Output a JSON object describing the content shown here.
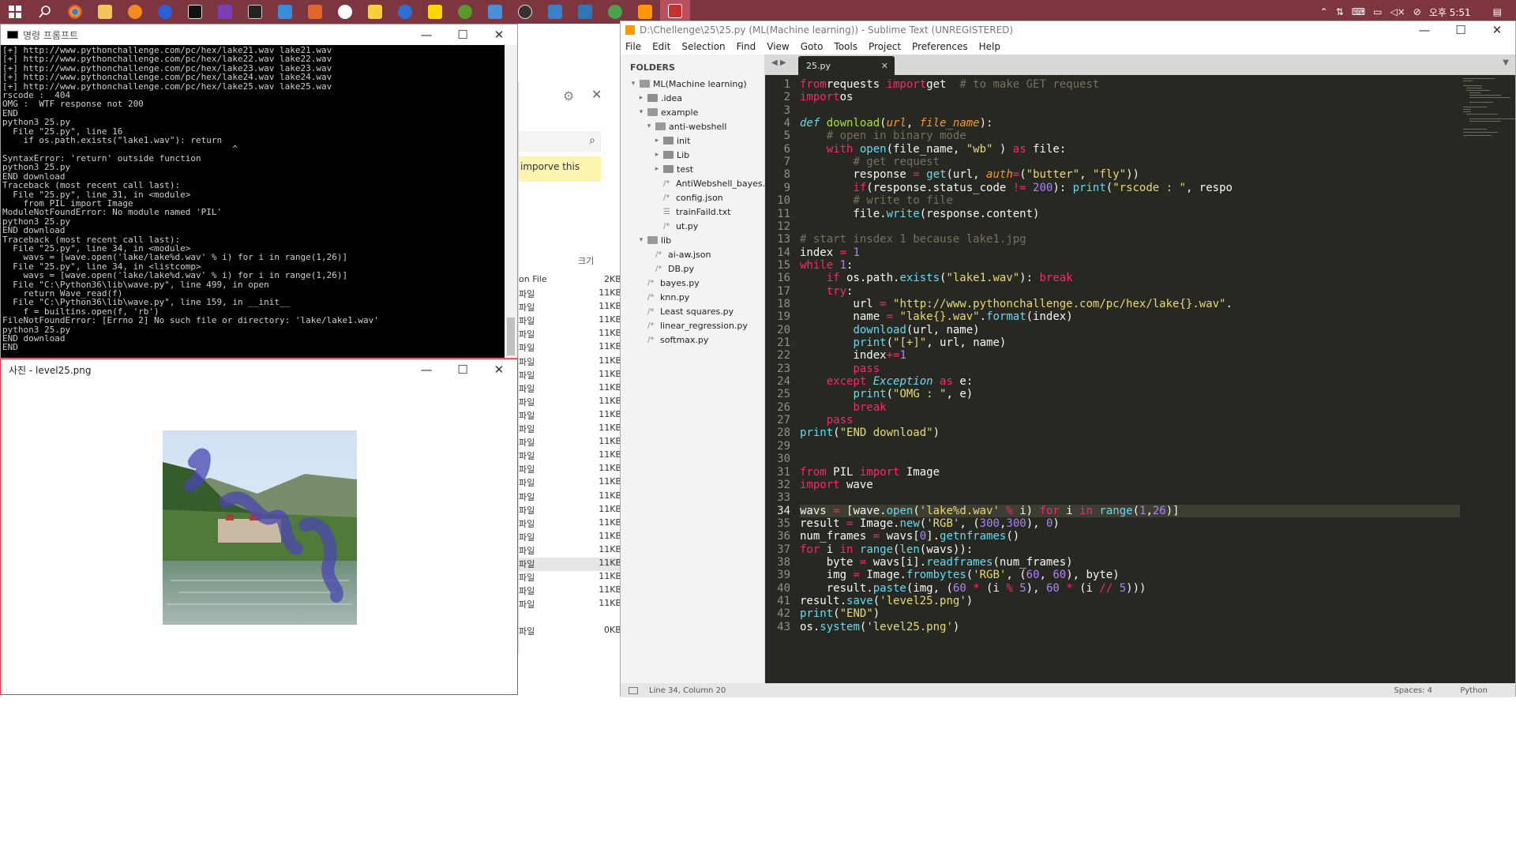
{
  "taskbar": {
    "clock": "오후 5:51"
  },
  "cmd": {
    "title": "명령 프롬프트",
    "lines": [
      "[+] http://www.pythonchallenge.com/pc/hex/lake21.wav lake21.wav",
      "[+] http://www.pythonchallenge.com/pc/hex/lake22.wav lake22.wav",
      "[+] http://www.pythonchallenge.com/pc/hex/lake23.wav lake23.wav",
      "[+] http://www.pythonchallenge.com/pc/hex/lake24.wav lake24.wav",
      "[+] http://www.pythonchallenge.com/pc/hex/lake25.wav lake25.wav",
      "rscode :  404",
      "OMG :  WTF response not 200",
      "END",
      "python3 25.py",
      "  File \"25.py\", line 16",
      "    if os.path.exists(\"lake1.wav\"): return",
      "                                            ^",
      "SyntaxError: 'return' outside function",
      "python3 25.py",
      "END download",
      "Traceback (most recent call last):",
      "  File \"25.py\", line 31, in <module>",
      "    from PIL import Image",
      "ModuleNotFoundError: No module named 'PIL'",
      "python3 25.py",
      "END download",
      "Traceback (most recent call last):",
      "  File \"25.py\", line 34, in <module>",
      "    wavs = [wave.open('lake/lake%d.wav' % i) for i in range(1,26)]",
      "  File \"25.py\", line 34, in <listcomp>",
      "    wavs = [wave.open('lake/lake%d.wav' % i) for i in range(1,26)]",
      "  File \"C:\\Python36\\lib\\wave.py\", line 499, in open",
      "    return Wave_read(f)",
      "  File \"C:\\Python36\\lib\\wave.py\", line 159, in __init__",
      "    f = builtins.open(f, 'rb')",
      "FileNotFoundError: [Errno 2] No such file or directory: 'lake/lake1.wav'",
      "python3 25.py",
      "END download",
      "END"
    ]
  },
  "photos": {
    "title": "사진 - level25.png"
  },
  "explorer": {
    "search_hint": "imporve this",
    "col_size": "크기",
    "first_type": "on File",
    "first_size": "2KB",
    "file_type": "파일",
    "file_size": "11KB",
    "last_size": "0KB"
  },
  "sublime": {
    "title": "D:\\Chellenge\\25\\25.py (ML(Machine learning)) - Sublime Text (UNREGISTERED)",
    "menu": [
      "File",
      "Edit",
      "Selection",
      "Find",
      "View",
      "Goto",
      "Tools",
      "Project",
      "Preferences",
      "Help"
    ],
    "folders_label": "FOLDERS",
    "tab": "25.py",
    "tree": [
      {
        "label": "ML(Machine learning)",
        "type": "folder-open",
        "depth": 0
      },
      {
        "label": ".idea",
        "type": "folder",
        "depth": 1
      },
      {
        "label": "example",
        "type": "folder-open",
        "depth": 1
      },
      {
        "label": "anti-webshell",
        "type": "folder-open",
        "depth": 2
      },
      {
        "label": "init",
        "type": "folder",
        "depth": 3
      },
      {
        "label": "Lib",
        "type": "folder",
        "depth": 3
      },
      {
        "label": "test",
        "type": "folder",
        "depth": 3
      },
      {
        "label": "AntiWebshell_bayes.py",
        "type": "file",
        "depth": 3
      },
      {
        "label": "config.json",
        "type": "file",
        "depth": 3
      },
      {
        "label": "trainFaild.txt",
        "type": "text",
        "depth": 3
      },
      {
        "label": "ut.py",
        "type": "file",
        "depth": 3
      },
      {
        "label": "lib",
        "type": "folder-open",
        "depth": 1
      },
      {
        "label": "ai-aw.json",
        "type": "file",
        "depth": 2
      },
      {
        "label": "DB.py",
        "type": "file",
        "depth": 2
      },
      {
        "label": "bayes.py",
        "type": "file",
        "depth": 1
      },
      {
        "label": "knn.py",
        "type": "file",
        "depth": 1
      },
      {
        "label": "Least squares.py",
        "type": "file",
        "depth": 1
      },
      {
        "label": "linear_regression.py",
        "type": "file",
        "depth": 1
      },
      {
        "label": "softmax.py",
        "type": "file",
        "depth": 1
      }
    ],
    "code": [
      [
        [
          "kw",
          "from"
        ],
        [
          "",
          "requests "
        ],
        [
          "kw",
          "import"
        ],
        [
          "",
          "get  "
        ],
        [
          "cm",
          "# to make GET request"
        ]
      ],
      [
        [
          "kw",
          "import"
        ],
        [
          "",
          "os"
        ]
      ],
      [],
      [
        [
          "it",
          "def "
        ],
        [
          "fn",
          "download"
        ],
        [
          "",
          "("
        ],
        [
          "pa",
          "url"
        ],
        [
          "",
          ", "
        ],
        [
          "pa",
          "file_name"
        ],
        [
          "",
          "):"
        ]
      ],
      [
        [
          "",
          "    "
        ],
        [
          "cm",
          "# open in binary mode"
        ]
      ],
      [
        [
          "",
          "    "
        ],
        [
          "kw",
          "with "
        ],
        [
          "bi",
          "open"
        ],
        [
          "",
          "(file_name, "
        ],
        [
          "st",
          "\"wb\""
        ],
        [
          "",
          " ) "
        ],
        [
          "kw",
          "as"
        ],
        [
          "",
          " file:"
        ]
      ],
      [
        [
          "",
          "        "
        ],
        [
          "cm",
          "# get request"
        ]
      ],
      [
        [
          "",
          "        response "
        ],
        [
          "kw",
          "="
        ],
        [
          "",
          " "
        ],
        [
          "bi",
          "get"
        ],
        [
          "",
          "(url, "
        ],
        [
          "pa",
          "auth"
        ],
        [
          "kw",
          "="
        ],
        [
          "",
          "("
        ],
        [
          "st",
          "\"butter\""
        ],
        [
          "",
          ", "
        ],
        [
          "st",
          "\"fly\""
        ],
        [
          "",
          "))"
        ]
      ],
      [
        [
          "",
          "        "
        ],
        [
          "kw",
          "if"
        ],
        [
          "",
          "(response.status_code "
        ],
        [
          "kw",
          "!="
        ],
        [
          "",
          " "
        ],
        [
          "nm",
          "200"
        ],
        [
          "",
          "): "
        ],
        [
          "bi",
          "print"
        ],
        [
          "",
          "("
        ],
        [
          "st",
          "\"rscode : \""
        ],
        [
          "",
          ", respo"
        ]
      ],
      [
        [
          "",
          "        "
        ],
        [
          "cm",
          "# write to file"
        ]
      ],
      [
        [
          "",
          "        file."
        ],
        [
          "bi",
          "write"
        ],
        [
          "",
          "(response.content)"
        ]
      ],
      [],
      [
        [
          "cm",
          "# start insdex 1 because lake1.jpg"
        ]
      ],
      [
        [
          "",
          "index "
        ],
        [
          "kw",
          "="
        ],
        [
          "",
          " "
        ],
        [
          "nm",
          "1"
        ]
      ],
      [
        [
          "kw",
          "while"
        ],
        [
          "",
          " "
        ],
        [
          "nm",
          "1"
        ],
        [
          "",
          ":"
        ]
      ],
      [
        [
          "",
          "    "
        ],
        [
          "kw",
          "if"
        ],
        [
          "",
          " os.path."
        ],
        [
          "bi",
          "exists"
        ],
        [
          "",
          "("
        ],
        [
          "st",
          "\"lake1.wav\""
        ],
        [
          "",
          "): "
        ],
        [
          "kw",
          "break"
        ]
      ],
      [
        [
          "",
          "    "
        ],
        [
          "kw",
          "try"
        ],
        [
          "",
          ":"
        ]
      ],
      [
        [
          "",
          "        url "
        ],
        [
          "kw",
          "="
        ],
        [
          "",
          " "
        ],
        [
          "st",
          "\"http://www.pythonchallenge.com/pc/hex/lake{}.wav\""
        ],
        [
          "",
          "."
        ]
      ],
      [
        [
          "",
          "        name "
        ],
        [
          "kw",
          "="
        ],
        [
          "",
          " "
        ],
        [
          "st",
          "\"lake{}.wav\""
        ],
        [
          "",
          "."
        ],
        [
          "bi",
          "format"
        ],
        [
          "",
          "(index)"
        ]
      ],
      [
        [
          "",
          "        "
        ],
        [
          "bi",
          "download"
        ],
        [
          "",
          "(url, name)"
        ]
      ],
      [
        [
          "",
          "        "
        ],
        [
          "bi",
          "print"
        ],
        [
          "",
          "("
        ],
        [
          "st",
          "\"[+]\""
        ],
        [
          "",
          ", url, name)"
        ]
      ],
      [
        [
          "",
          "        index"
        ],
        [
          "kw",
          "+="
        ],
        [
          "nm",
          "1"
        ]
      ],
      [
        [
          "",
          "        "
        ],
        [
          "kw",
          "pass"
        ]
      ],
      [
        [
          "",
          "    "
        ],
        [
          "kw",
          "except"
        ],
        [
          "",
          " "
        ],
        [
          "it",
          "Exception"
        ],
        [
          "",
          " "
        ],
        [
          "kw",
          "as"
        ],
        [
          "",
          " e:"
        ]
      ],
      [
        [
          "",
          "        "
        ],
        [
          "bi",
          "print"
        ],
        [
          "",
          "("
        ],
        [
          "st",
          "\"OMG : \""
        ],
        [
          "",
          ", e)"
        ]
      ],
      [
        [
          "",
          "        "
        ],
        [
          "kw",
          "break"
        ]
      ],
      [
        [
          "",
          "    "
        ],
        [
          "kw",
          "pass"
        ]
      ],
      [
        [
          "bi",
          "print"
        ],
        [
          "",
          "("
        ],
        [
          "st",
          "\"END download\""
        ],
        [
          "",
          ")"
        ]
      ],
      [],
      [],
      [
        [
          "kw",
          "from"
        ],
        [
          "",
          " PIL "
        ],
        [
          "kw",
          "import"
        ],
        [
          "",
          " Image"
        ]
      ],
      [
        [
          "kw",
          "import"
        ],
        [
          "",
          " wave"
        ]
      ],
      [],
      [
        [
          "",
          "wavs "
        ],
        [
          "kw",
          "="
        ],
        [
          "",
          " [wave."
        ],
        [
          "bi",
          "open"
        ],
        [
          "",
          "("
        ],
        [
          "st",
          "'lake%d.wav'"
        ],
        [
          "",
          " "
        ],
        [
          "kw",
          "%"
        ],
        [
          "",
          " i) "
        ],
        [
          "kw",
          "for"
        ],
        [
          "",
          " i "
        ],
        [
          "kw",
          "in"
        ],
        [
          "",
          " "
        ],
        [
          "bi",
          "range"
        ],
        [
          "",
          "("
        ],
        [
          "nm",
          "1"
        ],
        [
          "",
          ","
        ],
        [
          "nm",
          "26"
        ],
        [
          "",
          ")]"
        ]
      ],
      [
        [
          "",
          "result "
        ],
        [
          "kw",
          "="
        ],
        [
          "",
          " Image."
        ],
        [
          "bi",
          "new"
        ],
        [
          "",
          "("
        ],
        [
          "st",
          "'RGB'"
        ],
        [
          "",
          ", ("
        ],
        [
          "nm",
          "300"
        ],
        [
          "",
          ","
        ],
        [
          "nm",
          "300"
        ],
        [
          "",
          "), "
        ],
        [
          "nm",
          "0"
        ],
        [
          "",
          ")"
        ]
      ],
      [
        [
          "",
          "num_frames "
        ],
        [
          "kw",
          "="
        ],
        [
          "",
          " wavs["
        ],
        [
          "nm",
          "0"
        ],
        [
          "",
          "]."
        ],
        [
          "bi",
          "getnframes"
        ],
        [
          "",
          "()"
        ]
      ],
      [
        [
          "kw",
          "for"
        ],
        [
          "",
          " i "
        ],
        [
          "kw",
          "in"
        ],
        [
          "",
          " "
        ],
        [
          "bi",
          "range"
        ],
        [
          "",
          "("
        ],
        [
          "bi",
          "len"
        ],
        [
          "",
          "(wavs)):"
        ]
      ],
      [
        [
          "",
          "    byte "
        ],
        [
          "kw",
          "="
        ],
        [
          "",
          " wavs[i]."
        ],
        [
          "bi",
          "readframes"
        ],
        [
          "",
          "(num_frames)"
        ]
      ],
      [
        [
          "",
          "    img "
        ],
        [
          "kw",
          "="
        ],
        [
          "",
          " Image."
        ],
        [
          "bi",
          "frombytes"
        ],
        [
          "",
          "("
        ],
        [
          "st",
          "'RGB'"
        ],
        [
          "",
          ", ("
        ],
        [
          "nm",
          "60"
        ],
        [
          "",
          ", "
        ],
        [
          "nm",
          "60"
        ],
        [
          "",
          "), byte)"
        ]
      ],
      [
        [
          "",
          "    result."
        ],
        [
          "bi",
          "paste"
        ],
        [
          "",
          "(img, ("
        ],
        [
          "nm",
          "60"
        ],
        [
          "",
          " "
        ],
        [
          "kw",
          "*"
        ],
        [
          "",
          " (i "
        ],
        [
          "kw",
          "%"
        ],
        [
          "",
          " "
        ],
        [
          "nm",
          "5"
        ],
        [
          "",
          "), "
        ],
        [
          "nm",
          "60"
        ],
        [
          "",
          " "
        ],
        [
          "kw",
          "*"
        ],
        [
          "",
          " (i "
        ],
        [
          "kw",
          "//"
        ],
        [
          "",
          " "
        ],
        [
          "nm",
          "5"
        ],
        [
          "",
          ")))"
        ]
      ],
      [
        [
          "",
          "result."
        ],
        [
          "bi",
          "save"
        ],
        [
          "",
          "("
        ],
        [
          "st",
          "'level25.png'"
        ],
        [
          "",
          ")"
        ]
      ],
      [
        [
          "bi",
          "print"
        ],
        [
          "",
          "("
        ],
        [
          "st",
          "\"END\""
        ],
        [
          "",
          ")"
        ]
      ],
      [
        [
          "",
          "os."
        ],
        [
          "bi",
          "system"
        ],
        [
          "",
          "("
        ],
        [
          "st",
          "'level25.png'"
        ],
        [
          "",
          ")"
        ]
      ]
    ],
    "current_line": 34,
    "status_left": "Line 34, Column 20",
    "status_spaces": "Spaces: 4",
    "status_syntax": "Python"
  }
}
